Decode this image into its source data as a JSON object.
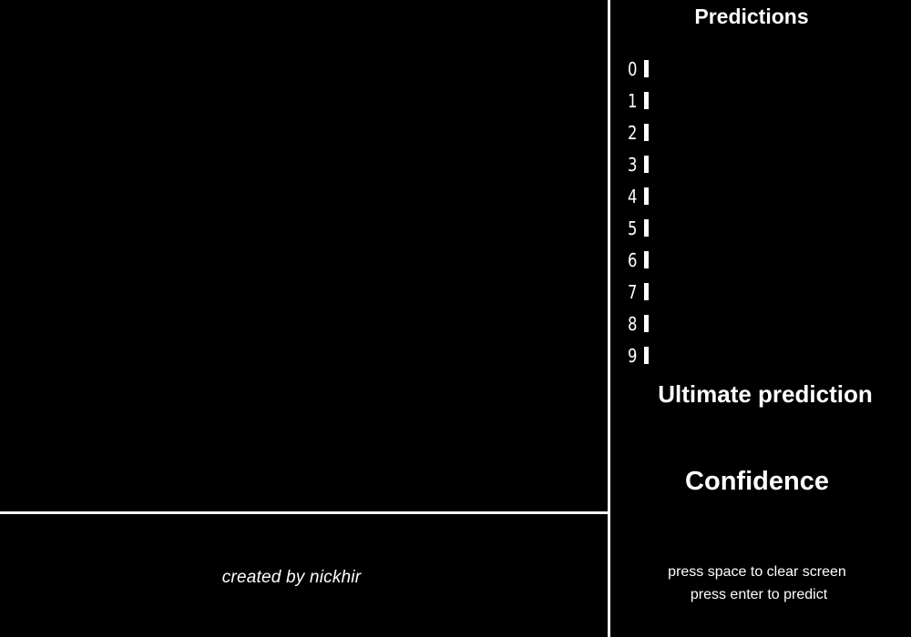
{
  "panel": {
    "title": "Predictions",
    "ultimate_label": "Ultimate prediction",
    "confidence_label": "Confidence"
  },
  "predictions": [
    {
      "digit": "0",
      "probability": 0
    },
    {
      "digit": "1",
      "probability": 0
    },
    {
      "digit": "2",
      "probability": 0
    },
    {
      "digit": "3",
      "probability": 0
    },
    {
      "digit": "4",
      "probability": 0
    },
    {
      "digit": "5",
      "probability": 0
    },
    {
      "digit": "6",
      "probability": 0
    },
    {
      "digit": "7",
      "probability": 0
    },
    {
      "digit": "8",
      "probability": 0
    },
    {
      "digit": "9",
      "probability": 0
    }
  ],
  "hints": {
    "clear": "press space to clear screen",
    "predict": "press enter to predict"
  },
  "footer": {
    "credit": "created by nickhir"
  },
  "colors": {
    "background": "#000000",
    "foreground": "#ffffff"
  }
}
